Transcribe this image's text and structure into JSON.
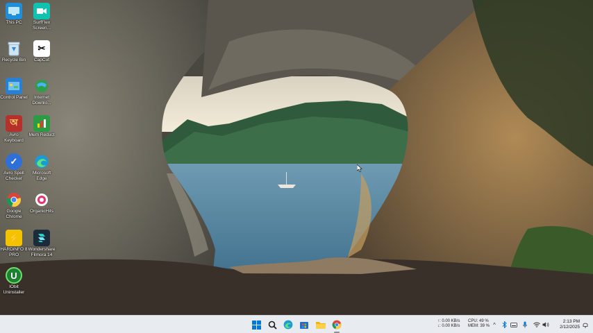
{
  "desktop": {
    "icons": [
      {
        "label": "This PC",
        "icon": "monitor-icon"
      },
      {
        "label": "SurfFlex Screen...",
        "icon": "surfflex-icon"
      },
      {
        "label": "Recycle Bin",
        "icon": "recycle-bin-icon"
      },
      {
        "label": "CapCut",
        "icon": "capcut-icon"
      },
      {
        "label": "Control Panel",
        "icon": "control-panel-icon"
      },
      {
        "label": "Internet Downlo...",
        "icon": "idm-icon"
      },
      {
        "label": "Avro Keyboard",
        "icon": "avro-keyboard-icon"
      },
      {
        "label": "Mem Reduct",
        "icon": "mem-reduct-icon"
      },
      {
        "label": "Avro Spell Checker",
        "icon": "avro-spell-icon"
      },
      {
        "label": "Microsoft Edge",
        "icon": "edge-icon"
      },
      {
        "label": "Google Chrome",
        "icon": "chrome-icon"
      },
      {
        "label": "OrganicHits",
        "icon": "organichits-icon"
      },
      {
        "label": "HARDiNFO 8 PRO",
        "icon": "hardinfo-icon"
      },
      {
        "label": "Wondershare Filmora 14",
        "icon": "filmora-icon"
      },
      {
        "label": "IObit Uninstaller",
        "icon": "iobit-icon"
      }
    ]
  },
  "taskbar": {
    "apps": [
      "windows-start-icon",
      "search-icon",
      "edge-icon",
      "store-icon",
      "file-explorer-icon",
      "chrome-icon"
    ],
    "network_up": "↑: 0.00 KB/s",
    "network_down": "↓: 0.00 KB/s",
    "cpu": "CPU: 49 %",
    "mem": "MEM: 39 %",
    "time": "2:13 PM",
    "date": "2/12/2025"
  },
  "colors": {
    "taskbar_bg": "#e8ebef",
    "accent_blue": "#0078d4"
  }
}
